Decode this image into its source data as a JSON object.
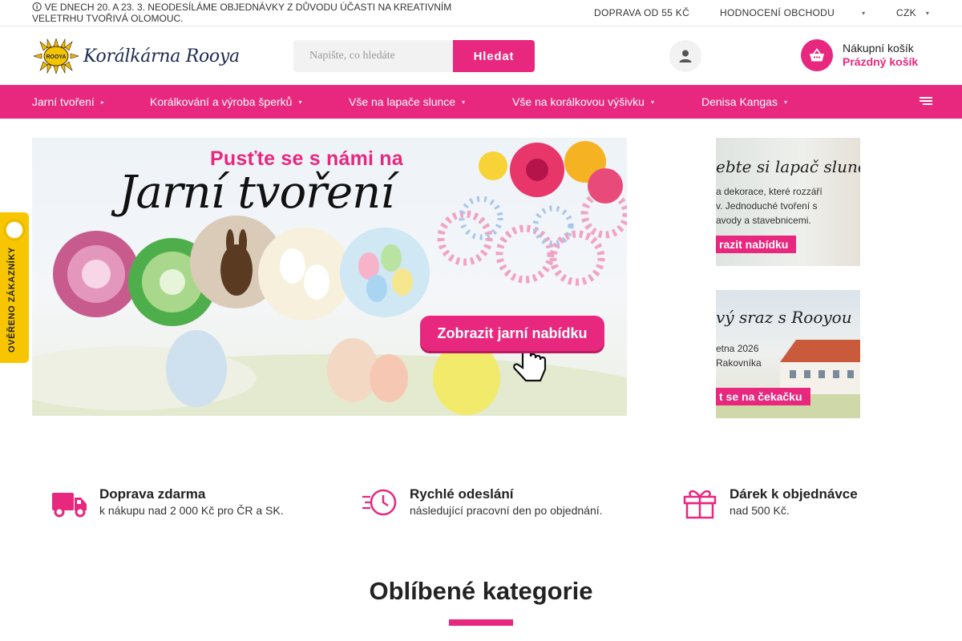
{
  "topbar": {
    "notice": "🛈 VE DNECH 20. A 23. 3. NEODESÍLÁME OBJEDNÁVKY Z DŮVODU ÚČASTI NA KREATIVNÍM VELETRHU TVOŘIVÁ OLOMOUC.",
    "shipping": "DOPRAVA OD 55 KČ",
    "rating": "HODNOCENÍ OBCHODU",
    "currency": "CZK"
  },
  "header": {
    "logo_text": "Korálkárna Rooya",
    "logo_badge": "ROOYA",
    "search_placeholder": "Napište, co hledáte",
    "search_button": "Hledat",
    "cart_title": "Nákupní košík",
    "cart_status": "Prázdný košík"
  },
  "nav": {
    "items": [
      {
        "label": "Jarní tvoření",
        "marker": "▸"
      },
      {
        "label": "Korálkování a výroba šperků",
        "marker": "▾"
      },
      {
        "label": "Vše na lapače slunce",
        "marker": "▾"
      },
      {
        "label": "Vše na korálkovou výšivku",
        "marker": "▾"
      },
      {
        "label": "Denisa Kangas",
        "marker": "▾"
      }
    ]
  },
  "hero": {
    "kicker": "Pusťte se s námi na",
    "title": "Jarní tvoření",
    "cta": "Zobrazit jarní nabídku"
  },
  "side_banners": [
    {
      "heading": "ebte si lapač slunce",
      "lines": [
        "a dekorace, které rozzáří",
        "v. Jednoduché tvoření s",
        "avody a stavebnicemi."
      ],
      "button": "razit nabídku"
    },
    {
      "heading": "vý sraz s Rooyou",
      "lines": [
        "etna 2026",
        "Rakovníka"
      ],
      "button": "t se na čekačku"
    }
  ],
  "verified_badge": {
    "text": "OVĚŘENO ZÁKAZNÍKY"
  },
  "benefits": [
    {
      "title": "Doprava zdarma",
      "text": "k nákupu nad 2 000 Kč pro ČR a SK.",
      "icon": "delivery-truck-icon"
    },
    {
      "title": "Rychlé odeslání",
      "text": "následující pracovní den po objednání.",
      "icon": "fast-clock-icon"
    },
    {
      "title": "Dárek k objednávce",
      "text": "nad 500 Kč.",
      "icon": "gift-icon"
    }
  ],
  "section": {
    "title": "Oblíbené kategorie"
  },
  "colors": {
    "accent": "#e8277e",
    "badge_yellow": "#f7c600"
  }
}
